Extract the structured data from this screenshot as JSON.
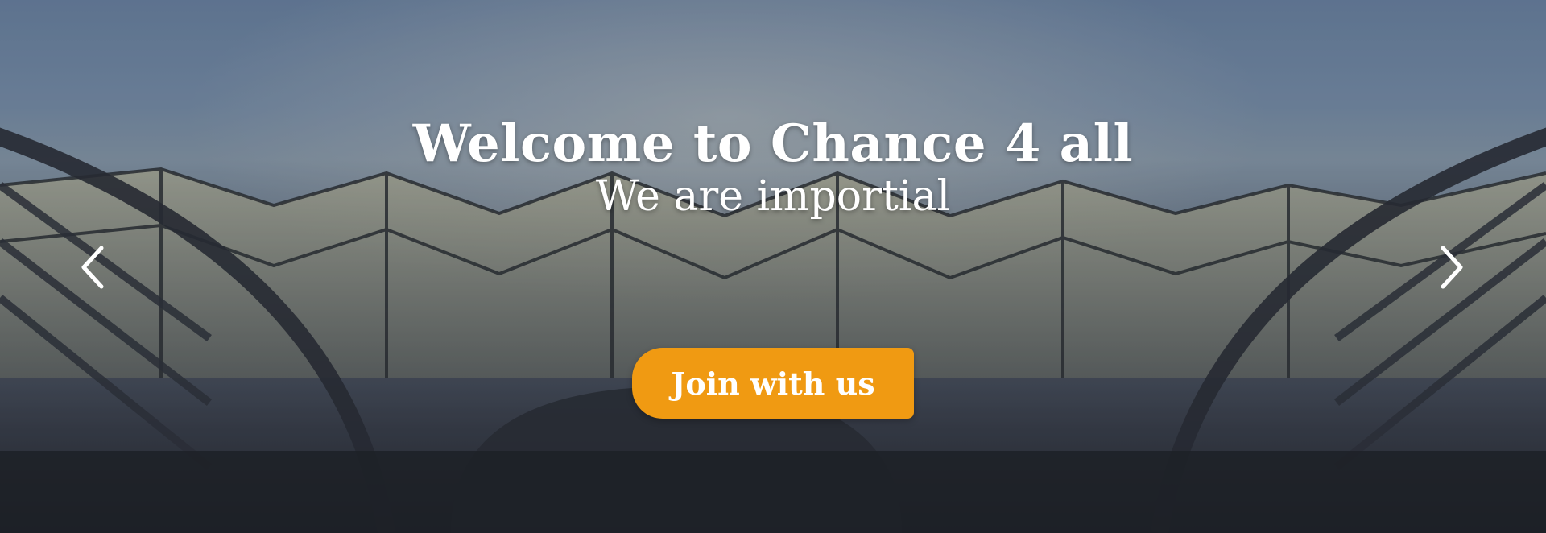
{
  "hero": {
    "title": "Welcome to Chance 4 all",
    "subtitle": "We are importial",
    "cta_label": "Join with us",
    "accent_color": "#f09a12"
  },
  "controls": {
    "prev_icon": "chevron-left-icon",
    "next_icon": "chevron-right-icon"
  },
  "background": {
    "description_icon": "station-roof-image"
  }
}
